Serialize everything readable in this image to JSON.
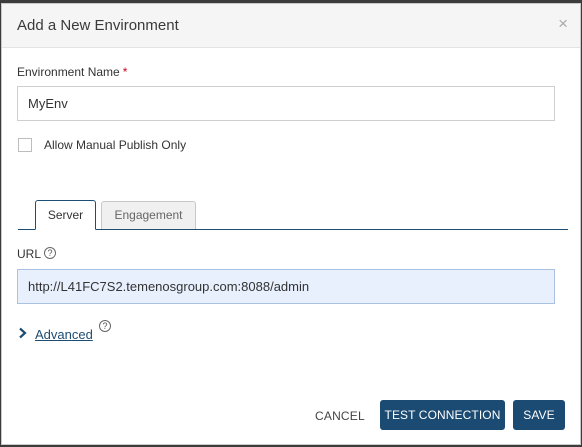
{
  "dialog": {
    "title": "Add a New Environment",
    "close_symbol": "×"
  },
  "form": {
    "env_name_label": "Environment Name",
    "env_name_required": "*",
    "env_name_value": "MyEnv",
    "manual_publish_label": "Allow Manual Publish Only",
    "manual_publish_checked": false
  },
  "tabs": [
    {
      "label": "Server",
      "active": true
    },
    {
      "label": "Engagement",
      "active": false
    }
  ],
  "server": {
    "url_label": "URL",
    "url_value": "http://L41FC7S2.temenosgroup.com:8088/admin",
    "help_symbol": "?",
    "advanced_label": "Advanced"
  },
  "footer": {
    "cancel_label": "CANCEL",
    "test_label": "TEST CONNECTION",
    "save_label": "SAVE"
  },
  "colors": {
    "primary": "#1b4a72",
    "required": "#d0021b",
    "url_bg": "#e8f0fe"
  },
  "icons": [
    "close-icon",
    "help-icon",
    "chevron-right-icon"
  ]
}
